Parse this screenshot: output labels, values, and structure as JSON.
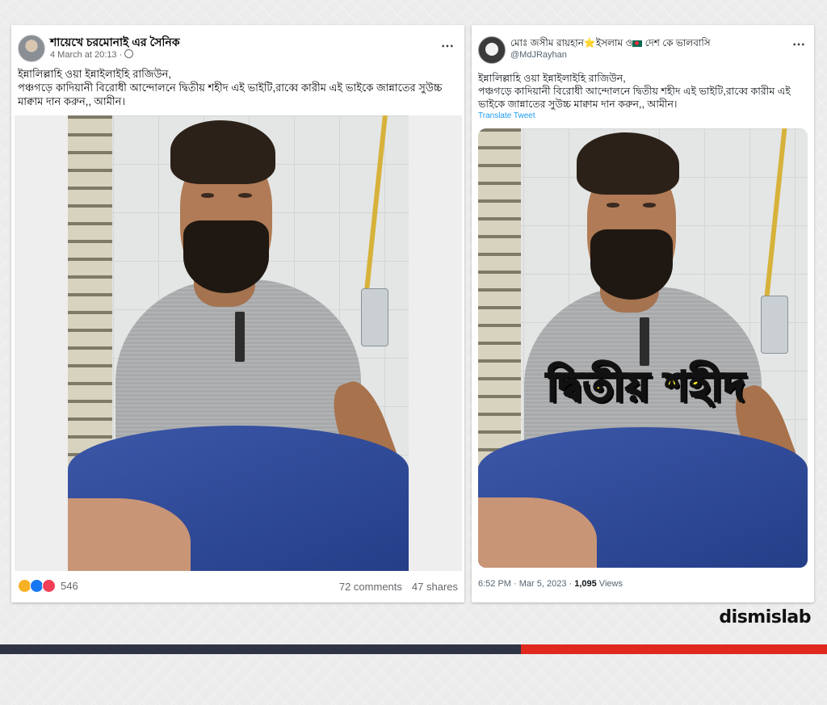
{
  "facebook_post": {
    "author": "শায়েখে চরমোনাই এর সৈনিক",
    "timestamp": "4 March at 20:13 ·",
    "text_line1": "ইন্নালিল্লাহি ওয়া ইন্নাইলাইহি রাজিউন,",
    "text_line2": "পঞ্চগড়ে কাদিয়ানী বিরোধী আন্দোলনে দ্বিতীয় শহীদ এই ভাইটি,রাব্বে কারীম এই ভাইকে জান্নাতের সুউচ্চ",
    "text_line3": "মাক্বাম দান করুন,, আমীন।",
    "reactions_count": "546",
    "comments": "72 comments",
    "shares": "47 shares",
    "more_icon": "⋯"
  },
  "tweet": {
    "display_name": "মোঃ জসীম রায়হান⭐ইসলাম ও",
    "display_name_tail": " দেশ কে ভালবাসি",
    "handle": "@MdJRayhan",
    "text_line1": "ইন্নালিল্লাহি ওয়া ইন্নাইলাইহি রাজিউন,",
    "text_line2": "পঞ্চগড়ে কাদিয়ানী বিরোধী আন্দোলনে দ্বিতীয় শহীদ এই ভাইটি,রাব্বে কারীম এই",
    "text_line3": "ভাইকে জান্নাতের সুউচ্চ মাক্বাম দান করুন,, আমীন।",
    "translate": "Translate Tweet",
    "image_overlay_text": "দ্বিতীয় শহীদ",
    "time_date": "6:52 PM · Mar 5, 2023 · ",
    "views_count": "1,095",
    "views_label": " Views",
    "more_icon": "⋯"
  },
  "brand": "dismislab",
  "colors": {
    "accent_red": "#e0281f",
    "dark_bar": "#2f3445",
    "link_blue": "#1d9bf0",
    "overlay_yellow": "#f7ea1c"
  }
}
